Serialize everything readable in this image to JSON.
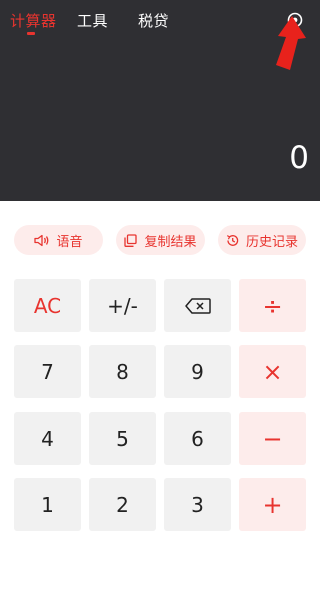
{
  "tabs": [
    {
      "label": "计算器",
      "active": true
    },
    {
      "label": "工具",
      "active": false
    },
    {
      "label": "税贷",
      "active": false
    }
  ],
  "display": {
    "value": "0"
  },
  "actions": {
    "voice": {
      "label": "语音",
      "icon": "speaker-icon"
    },
    "copy": {
      "label": "复制结果",
      "icon": "copy-icon"
    },
    "history": {
      "label": "历史记录",
      "icon": "history-icon"
    }
  },
  "keys": {
    "clear": "AC",
    "sign": "+/-",
    "backspace_icon": "backspace-icon",
    "divide": "÷",
    "seven": "7",
    "eight": "8",
    "nine": "9",
    "multiply": "×",
    "four": "4",
    "five": "5",
    "six": "6",
    "minus": "−",
    "one": "1",
    "two": "2",
    "three": "3",
    "plus": "+"
  },
  "colors": {
    "accent": "#e8342f",
    "header_bg": "#2f2f33",
    "key_bg": "#f1f1f1",
    "op_bg": "#fdeceb"
  }
}
